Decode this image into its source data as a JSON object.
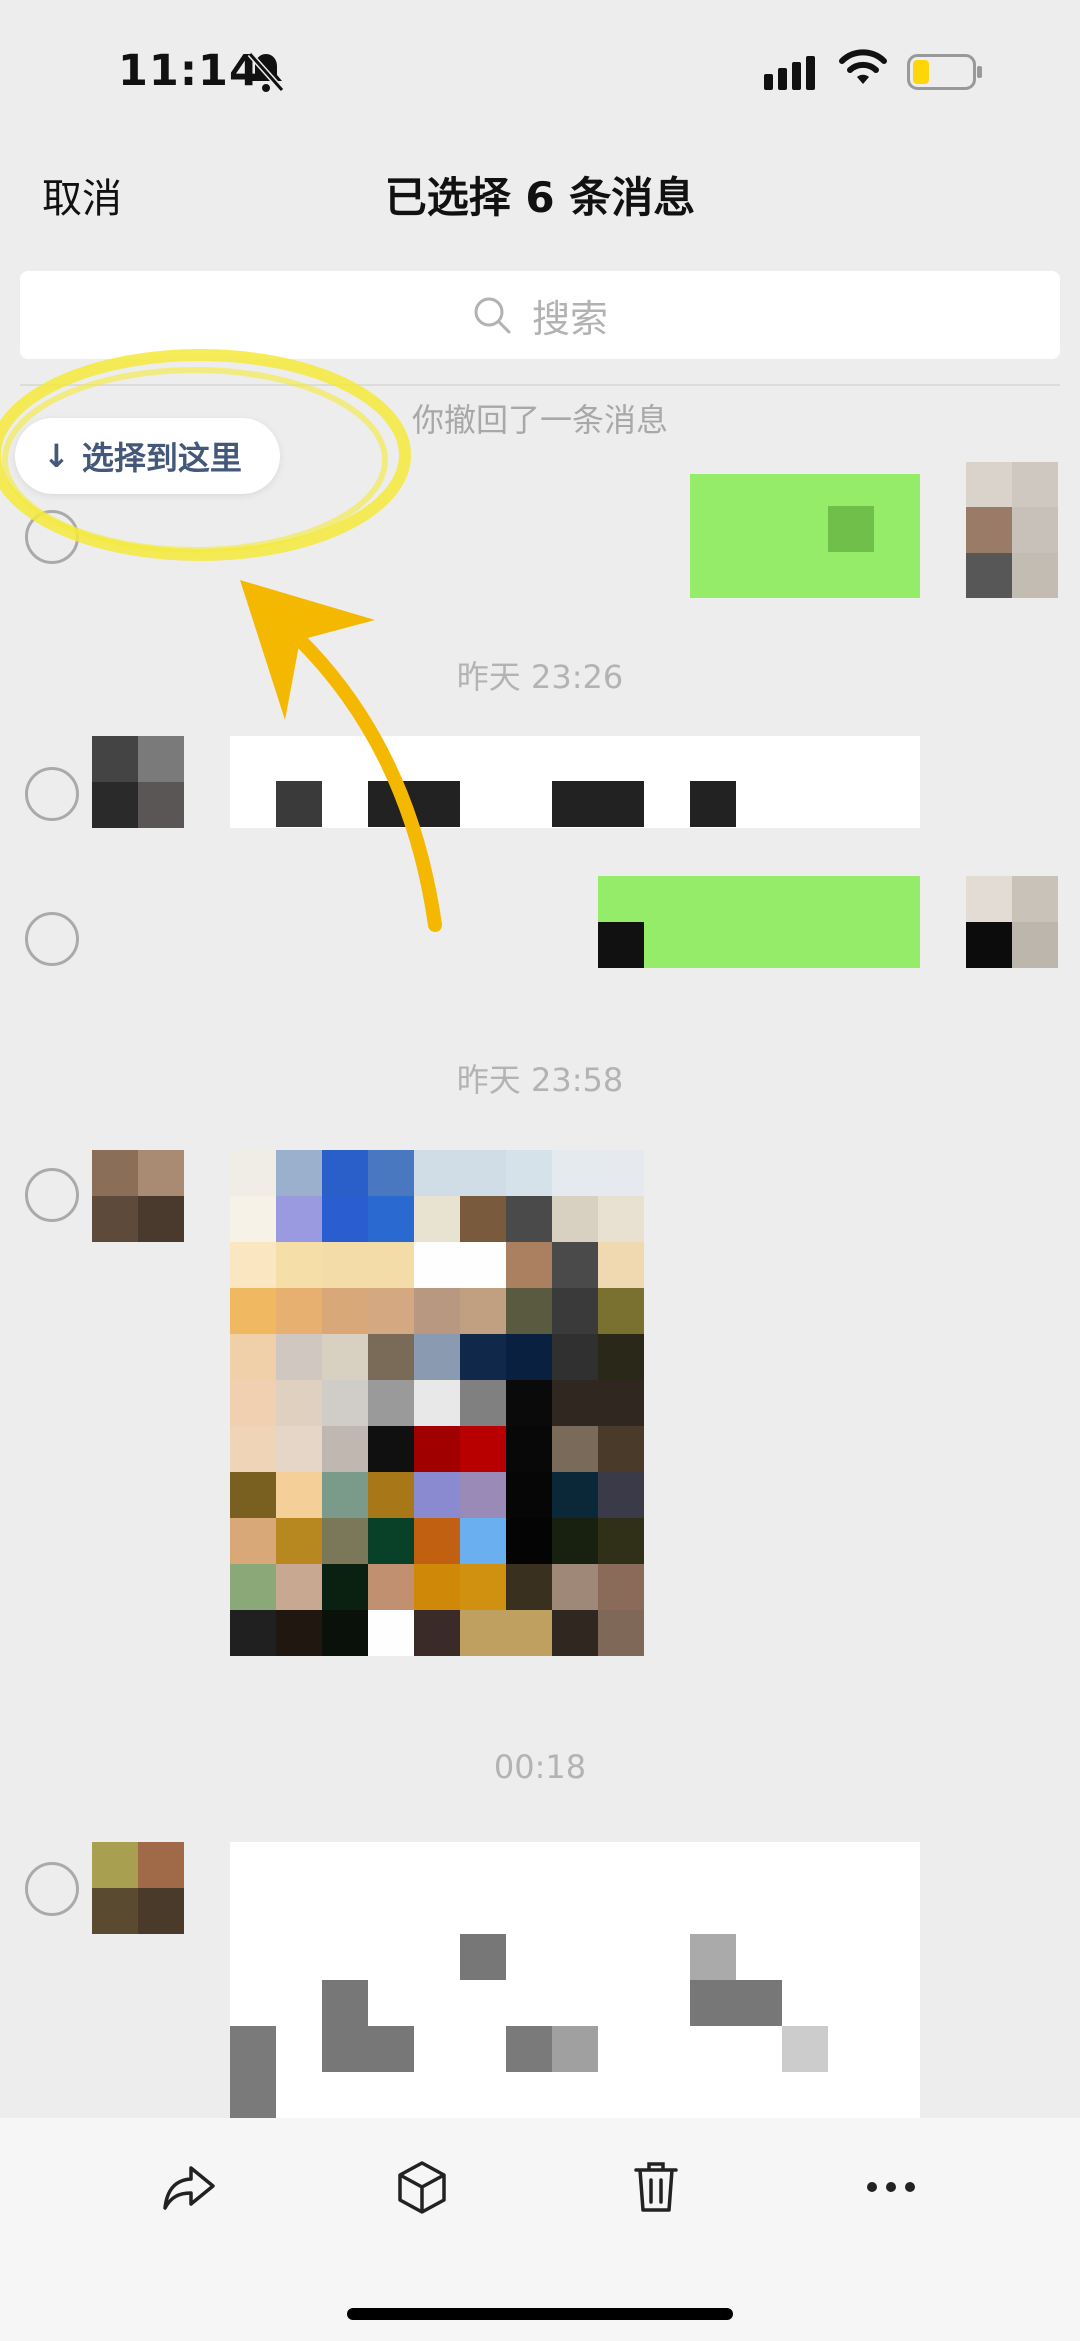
{
  "status_bar": {
    "time": "11:14"
  },
  "header": {
    "cancel_label": "取消",
    "title": "已选择 6 条消息"
  },
  "search": {
    "placeholder": "搜索"
  },
  "messages": {
    "recalled_notice": "你撤回了一条消息",
    "select_to_here": "选择到这里",
    "timestamps": [
      "昨天 23:26",
      "昨天 23:58",
      "00:18"
    ]
  },
  "toolbar": {
    "icons": [
      "forward-icon",
      "box-icon",
      "trash-icon",
      "more-icon"
    ]
  },
  "colors": {
    "background": "#ededed",
    "bubble_green": "#95ec69",
    "bubble_white": "#ffffff",
    "annotation_yellow": "#f4e93a",
    "annotation_arrow": "#f5b800"
  }
}
